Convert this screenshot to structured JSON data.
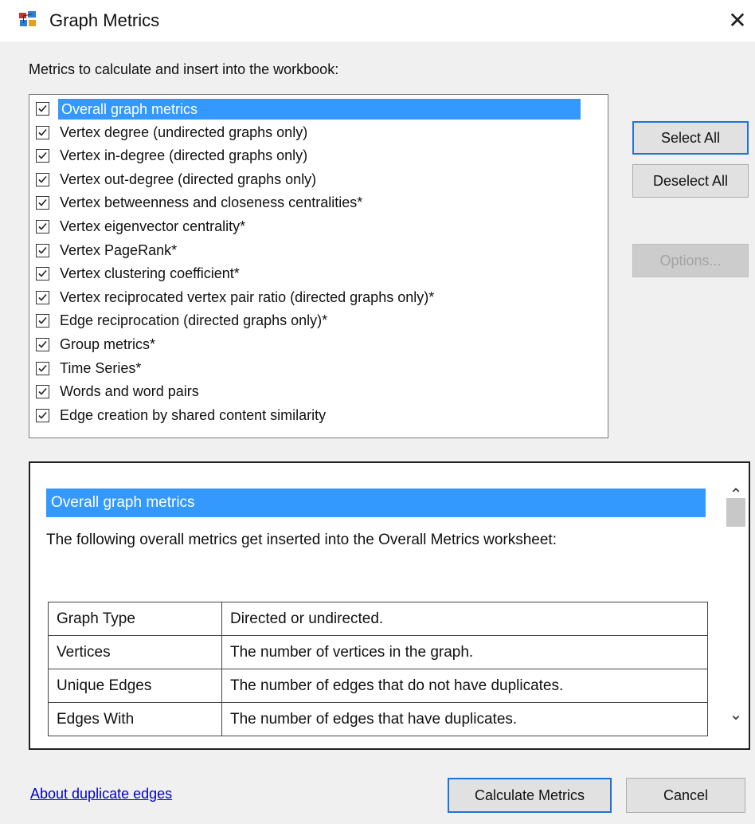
{
  "window": {
    "title": "Graph Metrics",
    "close_glyph": "✕",
    "icon": "graph-metrics-app-icon"
  },
  "metrics_label": "Metrics to calculate and insert into the workbook:",
  "metrics": [
    {
      "label": "Overall graph metrics",
      "checked": true,
      "selected": true
    },
    {
      "label": "Vertex degree (undirected graphs only)",
      "checked": true
    },
    {
      "label": "Vertex in-degree (directed graphs only)",
      "checked": true
    },
    {
      "label": "Vertex out-degree (directed graphs only)",
      "checked": true
    },
    {
      "label": "Vertex betweenness and closeness centralities*",
      "checked": true
    },
    {
      "label": "Vertex eigenvector centrality*",
      "checked": true
    },
    {
      "label": "Vertex PageRank*",
      "checked": true
    },
    {
      "label": "Vertex clustering coefficient*",
      "checked": true
    },
    {
      "label": "Vertex reciprocated vertex pair ratio (directed graphs only)*",
      "checked": true
    },
    {
      "label": "Edge reciprocation (directed graphs only)*",
      "checked": true
    },
    {
      "label": "Group metrics*",
      "checked": true
    },
    {
      "label": "Time Series*",
      "checked": true
    },
    {
      "label": "Words and word pairs",
      "checked": true
    },
    {
      "label": "Edge creation by shared content similarity",
      "checked": true
    }
  ],
  "buttons": {
    "select_all": "Select All",
    "deselect_all": "Deselect All",
    "options": "Options...",
    "calculate": "Calculate Metrics",
    "cancel": "Cancel"
  },
  "description": {
    "title": "Overall graph metrics",
    "text": "The following overall metrics get inserted into the Overall Metrics worksheet:",
    "table": [
      {
        "name": "Graph Type",
        "desc": "Directed or undirected."
      },
      {
        "name": "Vertices",
        "desc": "The number of vertices in the graph."
      },
      {
        "name": "Unique Edges",
        "desc": "The number of edges that do not have duplicates."
      },
      {
        "name": "Edges With",
        "desc": "The number of edges that have duplicates."
      }
    ]
  },
  "about_link": "About duplicate edges",
  "colors": {
    "selection": "#3399ff",
    "focus_border": "#1e73d8",
    "link": "#0000cc"
  }
}
